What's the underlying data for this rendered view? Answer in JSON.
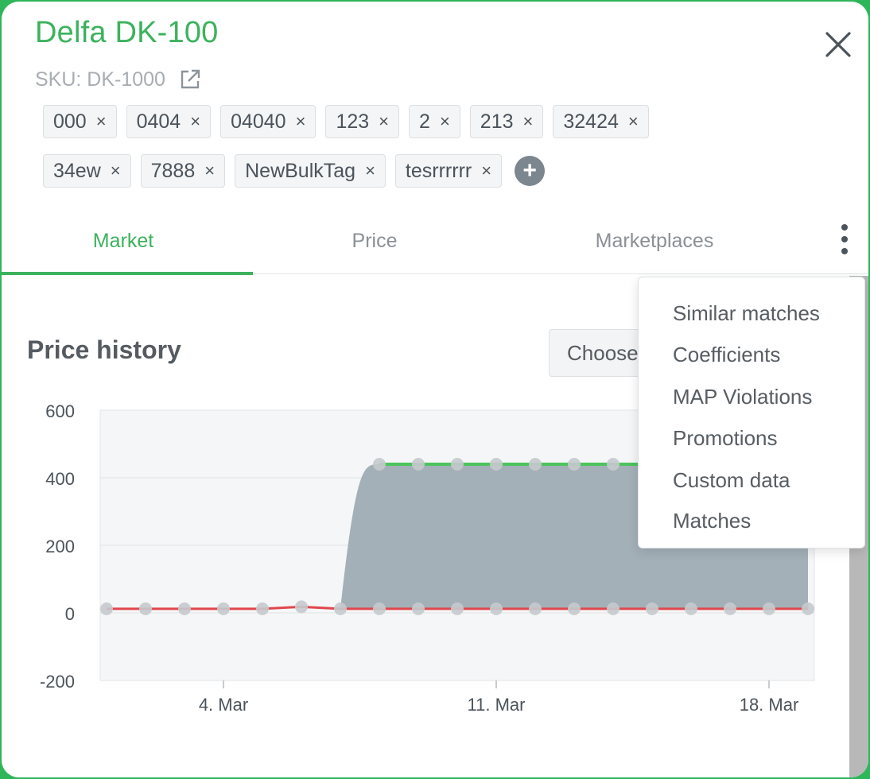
{
  "header": {
    "title": "Delfa DK-100",
    "sku": "SKU: DK-1000"
  },
  "tags": {
    "row1": [
      "000",
      "0404",
      "04040",
      "123",
      "2",
      "213",
      "32424"
    ],
    "row2": [
      "34ew",
      "7888",
      "NewBulkTag",
      "tesrrrrrr"
    ],
    "remove_glyph": "×"
  },
  "tabs": [
    {
      "label": "Market",
      "active": true
    },
    {
      "label": "Price",
      "active": false
    },
    {
      "label": "Marketplaces",
      "active": false
    }
  ],
  "section": {
    "title": "Price history",
    "choose_label": "Choose"
  },
  "menu": {
    "items": [
      "Similar matches",
      "Coefficients",
      "MAP Violations",
      "Promotions",
      "Custom data",
      "Matches"
    ]
  },
  "colors": {
    "accent": "#3cb25d",
    "series_green": "#4cc35c",
    "series_red": "#e0474c",
    "area_fill": "#a3b0b8",
    "point": "#c5cacd"
  },
  "chart_data": {
    "type": "area",
    "x": [
      "1. Mar",
      "2. Mar",
      "3. Mar",
      "4. Mar",
      "5. Mar",
      "6. Mar",
      "7. Mar",
      "8. Mar",
      "9. Mar",
      "10. Mar",
      "11. Mar",
      "12. Mar",
      "13. Mar",
      "14. Mar",
      "15. Mar",
      "16. Mar",
      "17. Mar",
      "18. Mar",
      "19. Mar"
    ],
    "x_tick_labels": [
      "4. Mar",
      "11. Mar",
      "18. Mar"
    ],
    "ylim": [
      -200,
      600
    ],
    "y_ticks": [
      600,
      400,
      200,
      0,
      -200
    ],
    "series": [
      {
        "values": [
          null,
          null,
          null,
          null,
          null,
          null,
          null,
          440,
          440,
          440,
          440,
          440,
          440,
          440,
          440,
          440,
          440,
          440,
          440
        ]
      },
      {
        "values": [
          12,
          12,
          12,
          12,
          12,
          18,
          12,
          12,
          12,
          12,
          12,
          12,
          12,
          12,
          12,
          12,
          12,
          12,
          12
        ]
      }
    ],
    "grid": true,
    "xlabel": "",
    "ylabel": ""
  }
}
